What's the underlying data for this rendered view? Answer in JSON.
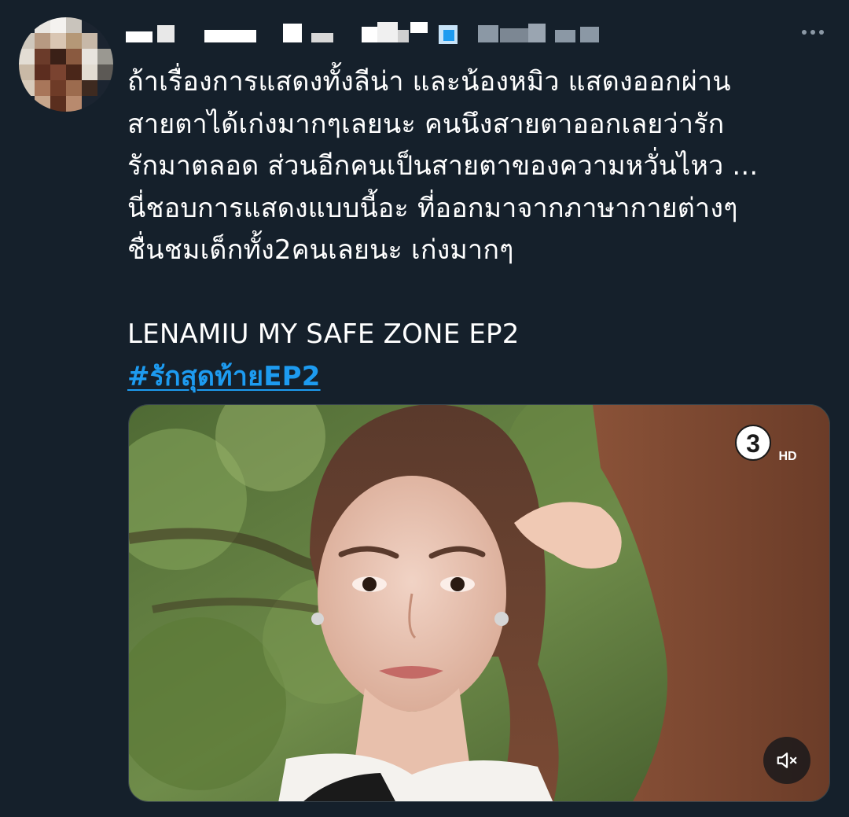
{
  "tweet": {
    "text_lines": [
      "ถ้าเรื่องการแสดงทั้งลีน่า และน้องหมิว แสดงออกผ่าน",
      "สายตาได้เก่งมากๆเลยนะ คนนึงสายตาออกเลยว่ารัก",
      "รักมาตลอด ส่วนอีกคนเป็นสายตาของความหวั่นไหว ...",
      "นี่ชอบการแสดงแบบนี้อะ ที่ออกมาจากภาษากายต่างๆ",
      "ชื่นชมเด็กทั้ง2คนเลยนะ เก่งมากๆ"
    ],
    "title_line": "LENAMIU MY SAFE ZONE EP2",
    "hashtag": "#รักสุดท้ายEP2"
  },
  "media": {
    "channel_logo_text": "3",
    "channel_logo_hd": "HD"
  },
  "icons": {
    "more": "more-horizontal-icon",
    "mute": "volume-muted-icon"
  },
  "colors": {
    "background": "#15202b",
    "text": "#ffffff",
    "link": "#1d9bf0",
    "secondary": "#8b98a5"
  }
}
